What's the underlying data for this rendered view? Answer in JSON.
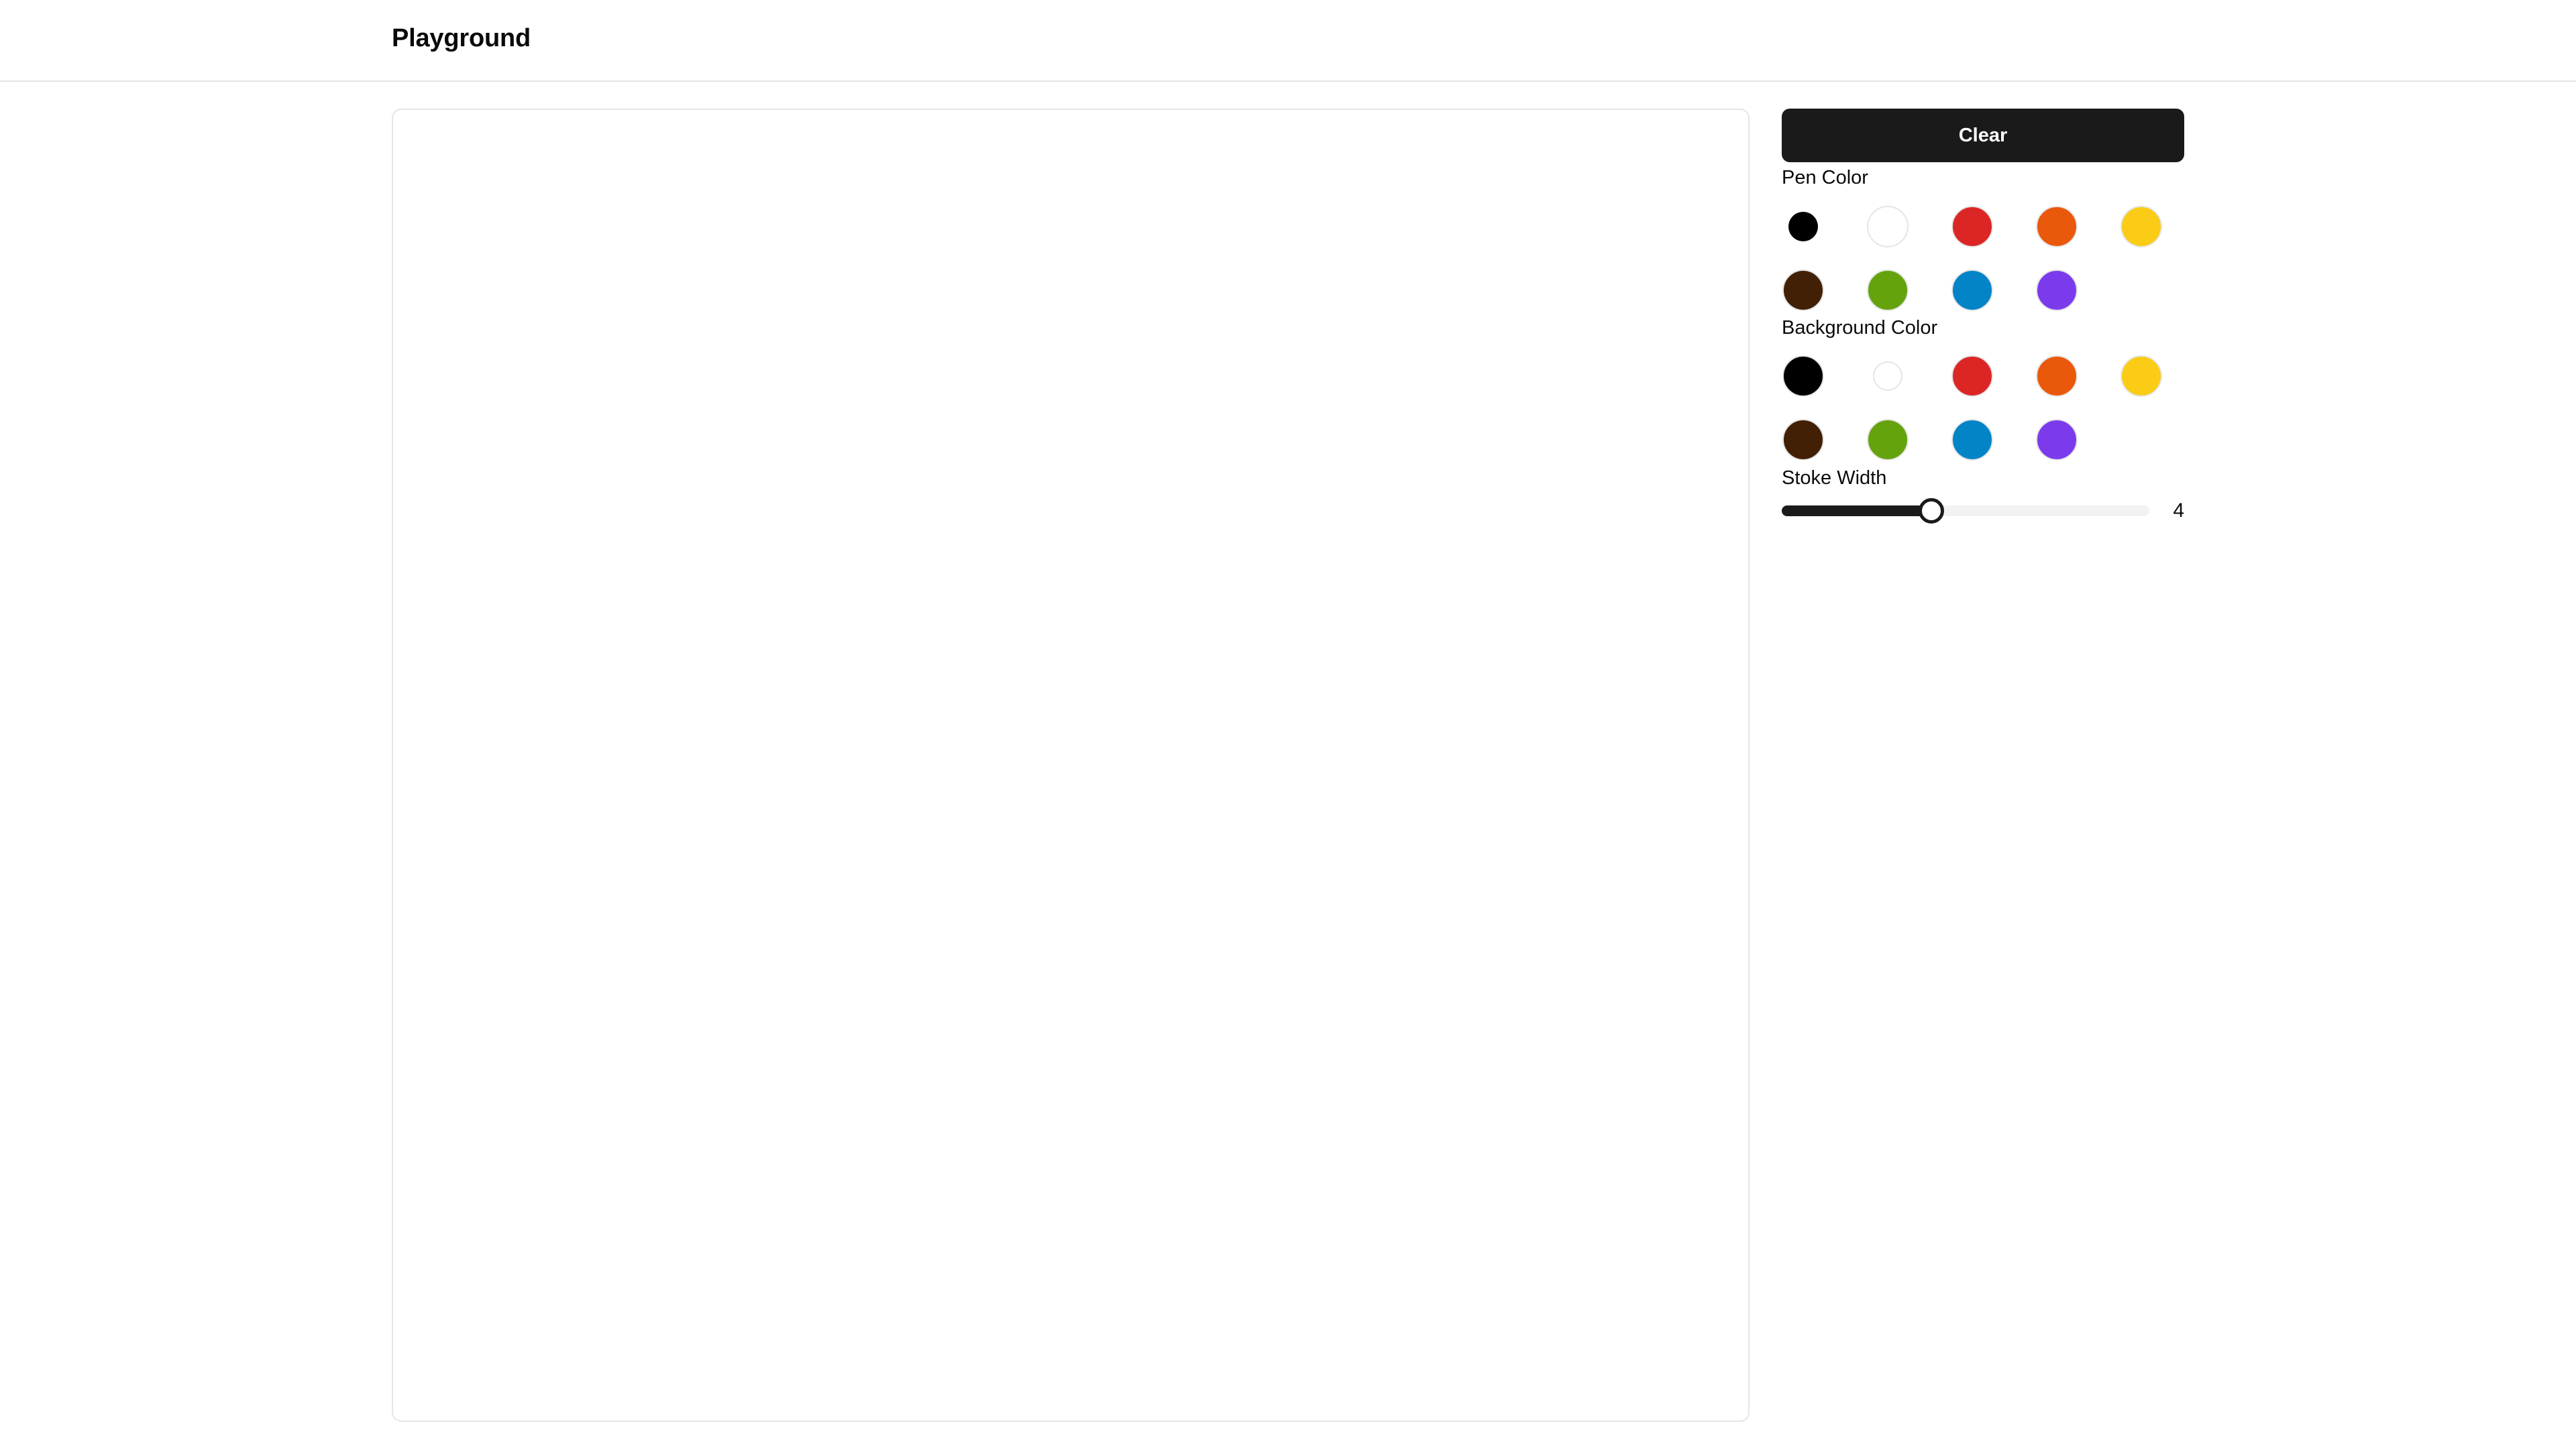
{
  "header": {
    "title": "Playground"
  },
  "sidebar": {
    "clear_label": "Clear",
    "pen_color": {
      "label": "Pen Color",
      "selected": "black",
      "swatches": [
        {
          "name": "black",
          "color": "#000000"
        },
        {
          "name": "white",
          "color": "#ffffff"
        },
        {
          "name": "red",
          "color": "#dc2626"
        },
        {
          "name": "orange",
          "color": "#ea580c"
        },
        {
          "name": "yellow",
          "color": "#facc15"
        },
        {
          "name": "brown",
          "color": "#422006"
        },
        {
          "name": "green",
          "color": "#65a30d"
        },
        {
          "name": "blue",
          "color": "#0284c7"
        },
        {
          "name": "purple",
          "color": "#7c3aed"
        }
      ]
    },
    "background_color": {
      "label": "Background Color",
      "selected": "white",
      "swatches": [
        {
          "name": "black",
          "color": "#000000"
        },
        {
          "name": "white",
          "color": "#ffffff"
        },
        {
          "name": "red",
          "color": "#dc2626"
        },
        {
          "name": "orange",
          "color": "#ea580c"
        },
        {
          "name": "yellow",
          "color": "#facc15"
        },
        {
          "name": "brown",
          "color": "#422006"
        },
        {
          "name": "green",
          "color": "#65a30d"
        },
        {
          "name": "blue",
          "color": "#0284c7"
        },
        {
          "name": "purple",
          "color": "#7c3aed"
        }
      ]
    },
    "stroke_width": {
      "label": "Stoke Width",
      "value": 4,
      "value_text": "4",
      "min": 0,
      "max": 10
    }
  }
}
